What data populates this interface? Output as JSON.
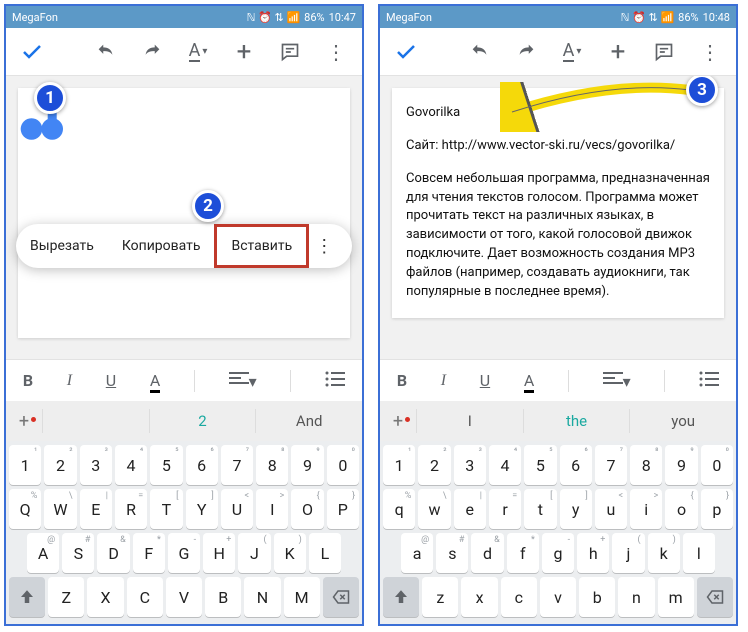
{
  "status": {
    "carrier": "MegaFon",
    "battery": "86%",
    "time_left": "10:47",
    "time_right": "10:48",
    "icons": "ℕ ⏰ ⇅ 📶"
  },
  "toolbar": {
    "check": "✓",
    "undo": "↶",
    "redo": "↷",
    "format": "A̲",
    "plus": "+",
    "comment": "▤",
    "more": "⋮"
  },
  "contextMenu": {
    "cut": "Вырезать",
    "copy": "Копировать",
    "paste": "Вставить"
  },
  "doc": {
    "title": "Govorilka",
    "site_label": "Сайт: http://www.vector-ski.ru/vecs/govorilka/",
    "body": "Совсем небольшая программа, предназначенная для чтения текстов голосом. Программа может прочитать текст на различных языках, в зависимости от того, какой голосовой движок подключите. Дает возможность создания MP3 файлов (например, создавать аудиокниги, так популярные в последнее время)."
  },
  "formatbar": {
    "bold": "B",
    "italic": "I",
    "underline": "U",
    "color": "A"
  },
  "suggestions_left": {
    "s1": "",
    "s2": "2",
    "s3": "And"
  },
  "suggestions_right": {
    "s1": "I",
    "s2": "the",
    "s3": "you"
  },
  "kbd_rows": {
    "r1": [
      [
        "1",
        "¹"
      ],
      [
        "2",
        "²"
      ],
      [
        "3",
        "³"
      ],
      [
        "4",
        "⁴"
      ],
      [
        "5",
        "⁵"
      ],
      [
        "6",
        "⁶"
      ],
      [
        "7",
        "⁷"
      ],
      [
        "8",
        "⁸"
      ],
      [
        "9",
        "⁹"
      ],
      [
        "0",
        "⁰"
      ]
    ],
    "r2_left": [
      [
        "q",
        "%"
      ],
      [
        "w",
        "\\"
      ],
      [
        "e",
        "|"
      ],
      [
        "r",
        "="
      ],
      [
        "t",
        "["
      ],
      [
        "y",
        "]"
      ],
      [
        "u",
        "<"
      ],
      [
        "i",
        ">"
      ],
      [
        "o",
        "{"
      ],
      [
        "p",
        "}"
      ]
    ],
    "r2_right": [
      [
        "q",
        "%"
      ],
      [
        "w",
        "\\"
      ],
      [
        "e",
        "|"
      ],
      [
        "r",
        "="
      ],
      [
        "t",
        "["
      ],
      [
        "y",
        "]"
      ],
      [
        "u",
        "<"
      ],
      [
        "i",
        ">"
      ],
      [
        "o",
        "{"
      ],
      [
        "p",
        "}"
      ]
    ],
    "r3": [
      [
        "a",
        "@"
      ],
      [
        "s",
        "#"
      ],
      [
        "d",
        "&"
      ],
      [
        "f",
        "*"
      ],
      [
        "g",
        "-"
      ],
      [
        "h",
        "+"
      ],
      [
        "j",
        "("
      ],
      [
        "k",
        ")"
      ],
      [
        "l",
        ""
      ]
    ],
    "r4": [
      [
        "z",
        ""
      ],
      [
        "x",
        ""
      ],
      [
        "c",
        ""
      ],
      [
        "v",
        ""
      ],
      [
        "b",
        ""
      ],
      [
        "n",
        ""
      ],
      [
        "m",
        ""
      ]
    ]
  },
  "badges": {
    "b1": "1",
    "b2": "2",
    "b3": "3"
  }
}
